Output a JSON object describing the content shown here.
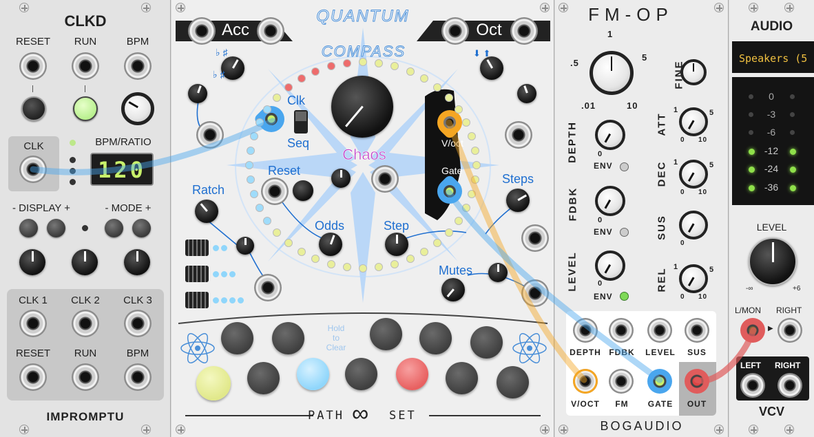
{
  "clkd": {
    "title": "CLKD",
    "buttons": {
      "reset": "RESET",
      "run": "RUN",
      "bpm": "BPM"
    },
    "clk_label": "CLK",
    "bpm_ratio_label": "BPM/RATIO",
    "display_value": "120",
    "display_ctrl": "- DISPLAY +",
    "mode_ctrl": "- MODE +",
    "outputs_row1": [
      "CLK 1",
      "CLK 2",
      "CLK 3"
    ],
    "outputs_row2": [
      "RESET",
      "RUN",
      "BPM"
    ],
    "brand": "IMPROMPTU"
  },
  "qc": {
    "title_line1": "QUANTUM",
    "title_line2": "COMPASS",
    "acc": "Acc",
    "oct": "Oct",
    "clk": "Clk",
    "seq": "Seq",
    "chaos": "Chaos",
    "reset": "Reset",
    "ratch": "Ratch",
    "odds": "Odds",
    "step": "Step",
    "voct": "V/oct",
    "gate": "Gate",
    "steps": "Steps",
    "mutes": "Mutes",
    "hold_to_clear": "Hold\nto\nClear",
    "footer": "PATH",
    "footer2": "SET",
    "colors": {
      "yellow": "#e9ef9a",
      "blue": "#9fdcfb",
      "red": "#ee6c6c",
      "accent": "#1f6fd0"
    }
  },
  "fmop": {
    "title": "FM-OP",
    "ratio_ticks": [
      ".5",
      "1",
      "5",
      ".01",
      "10"
    ],
    "fine": "FINE",
    "depth": "DEPTH",
    "fdbk": "FDBK",
    "level": "LEVEL",
    "env": "ENV",
    "att": "ATT",
    "dec": "DEC",
    "sus": "SUS",
    "rel": "REL",
    "tick_1": "1",
    "tick_5": "5",
    "tick_0": "0",
    "tick_10": "10",
    "jack_labels_row1": [
      "DEPTH",
      "FDBK",
      "LEVEL",
      "SUS"
    ],
    "jack_labels_row2": [
      "V/OCT",
      "FM",
      "GATE",
      "OUT"
    ],
    "brand": "BOGAUDIO"
  },
  "audio": {
    "title": "AUDIO",
    "device": "Speakers (5",
    "meter_labels": [
      "0",
      "-3",
      "-6",
      "-12",
      "-24",
      "-36"
    ],
    "level_label": "LEVEL",
    "level_min": "-∞",
    "level_max": "+6",
    "lmon": "L/MON",
    "right_in": "RIGHT",
    "left_out": "LEFT",
    "right_out": "RIGHT",
    "brand": "VCV"
  }
}
